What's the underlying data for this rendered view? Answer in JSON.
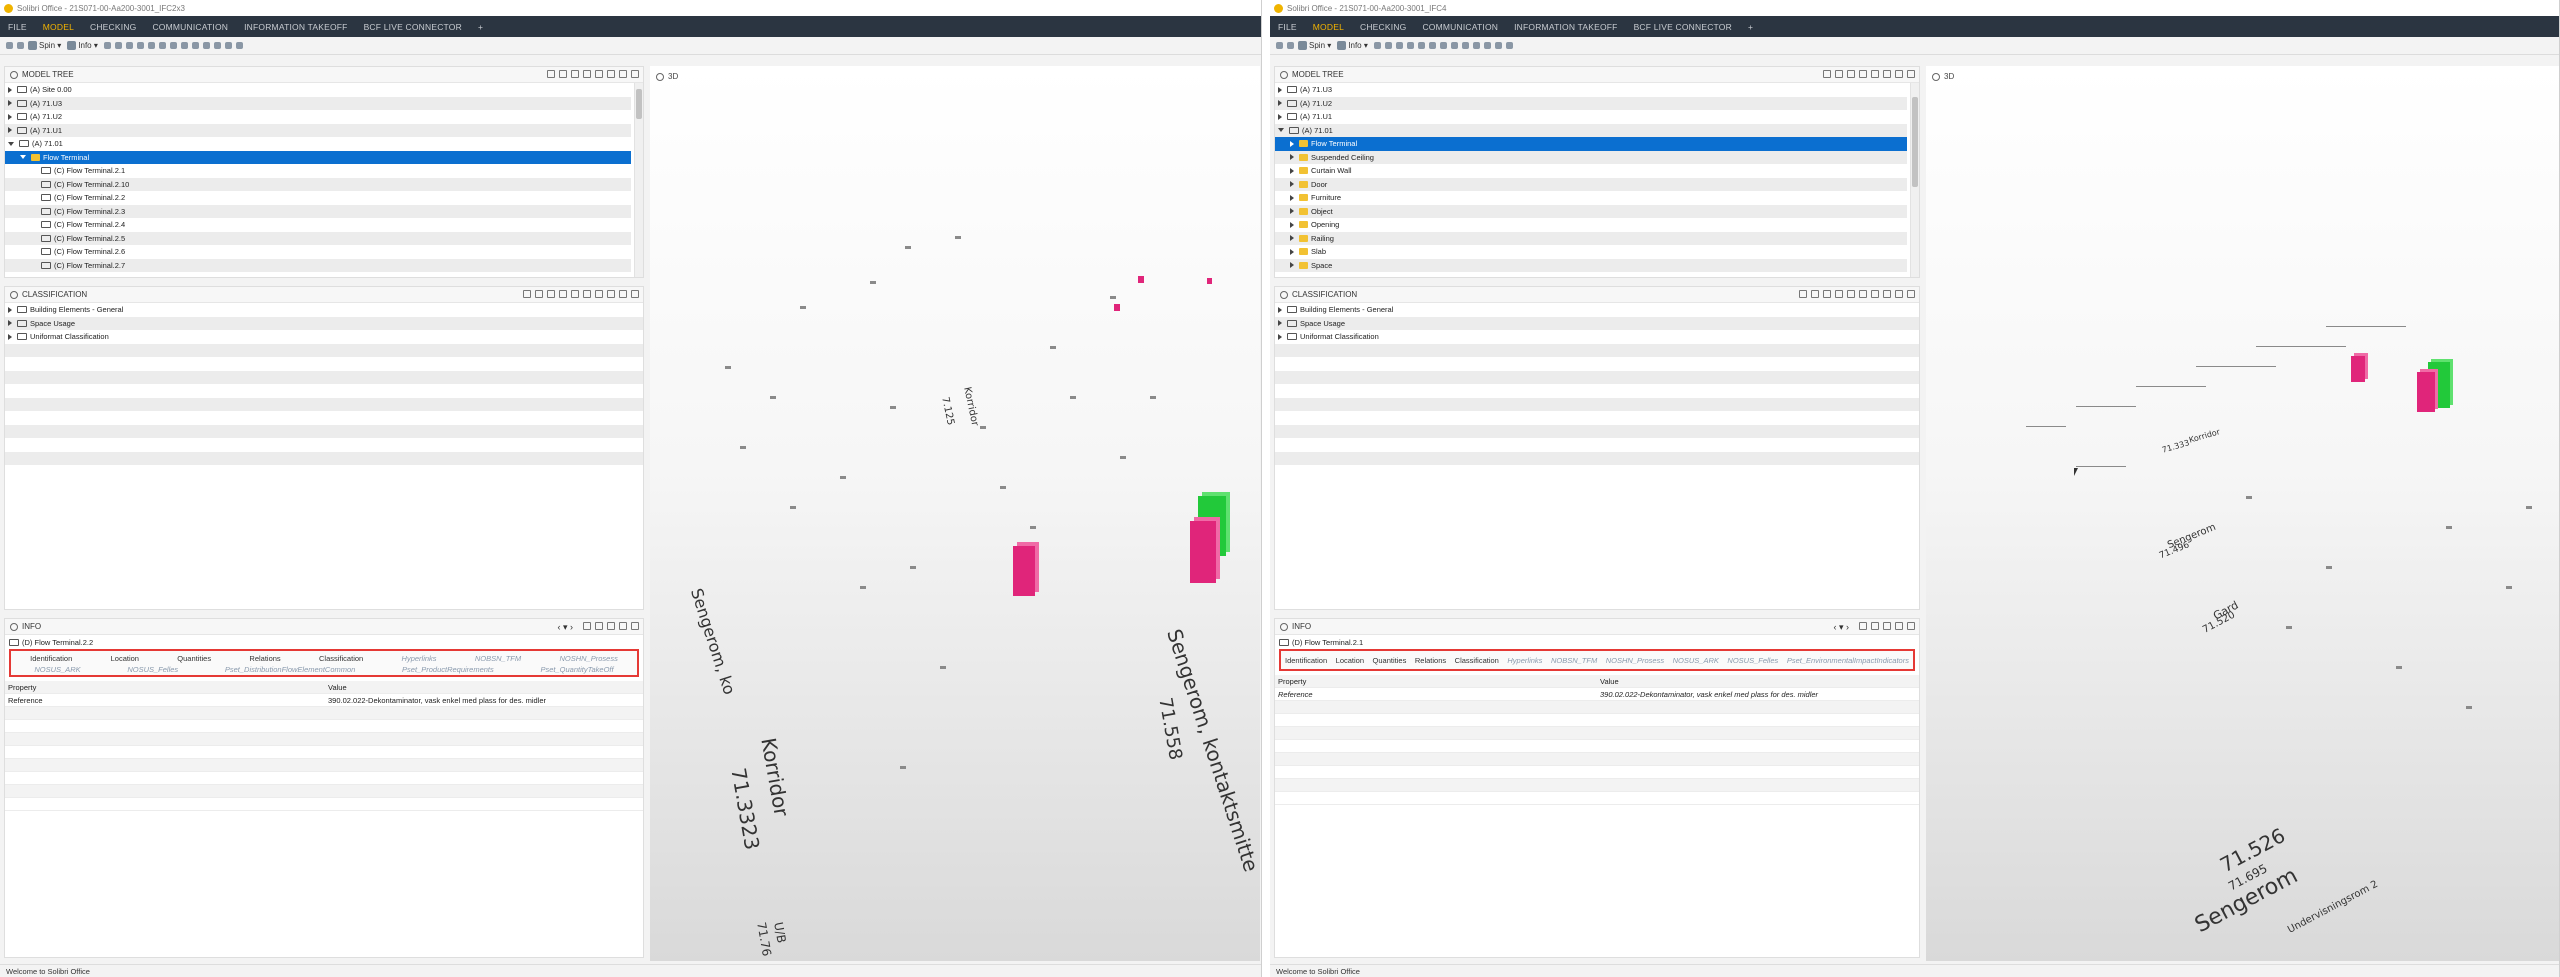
{
  "left": {
    "title": "Solibri Office - 21S071-00-Aa200-3001_IFC2x3",
    "menu": [
      "FILE",
      "MODEL",
      "CHECKING",
      "COMMUNICATION",
      "INFORMATION TAKEOFF",
      "BCF LIVE CONNECTOR"
    ],
    "active_menu": "MODEL",
    "toolbar": {
      "spin": "Spin",
      "info": "Info"
    },
    "model_tree": {
      "header": "MODEL TREE",
      "rows": [
        {
          "label": "(A) Site 0.00",
          "indent": 0,
          "state": "closed"
        },
        {
          "label": "(A) 71.U3",
          "indent": 0,
          "state": "closed"
        },
        {
          "label": "(A) 71.U2",
          "indent": 0,
          "state": "closed"
        },
        {
          "label": "(A) 71.U1",
          "indent": 0,
          "state": "closed"
        },
        {
          "label": "(A) 71.01",
          "indent": 0,
          "state": "open"
        },
        {
          "label": "Flow Terminal",
          "indent": 1,
          "state": "open",
          "selected": true,
          "folder": true
        },
        {
          "label": "(C) Flow Terminal.2.1",
          "indent": 2,
          "state": "leaf"
        },
        {
          "label": "(C) Flow Terminal.2.10",
          "indent": 2,
          "state": "leaf"
        },
        {
          "label": "(C) Flow Terminal.2.2",
          "indent": 2,
          "state": "leaf"
        },
        {
          "label": "(C) Flow Terminal.2.3",
          "indent": 2,
          "state": "leaf"
        },
        {
          "label": "(C) Flow Terminal.2.4",
          "indent": 2,
          "state": "leaf"
        },
        {
          "label": "(C) Flow Terminal.2.5",
          "indent": 2,
          "state": "leaf"
        },
        {
          "label": "(C) Flow Terminal.2.6",
          "indent": 2,
          "state": "leaf"
        },
        {
          "label": "(C) Flow Terminal.2.7",
          "indent": 2,
          "state": "leaf"
        }
      ]
    },
    "classification": {
      "header": "CLASSIFICATION",
      "rows": [
        "Building Elements - General",
        "Space Usage",
        "Uniformat Classification"
      ]
    },
    "info": {
      "header": "INFO",
      "selected": "(D) Flow Terminal.2.2",
      "tabs_row1": [
        "Identification",
        "Location",
        "Quantities",
        "Relations",
        "Classification",
        "Hyperlinks",
        "NOBSN_TFM",
        "NOSHN_Prosess"
      ],
      "tabs_row2": [
        "NOSUS_ARK",
        "NOSUS_Felles",
        "Pset_DistributionFlowElementCommon",
        "Pset_ProductRequirements",
        "Pset_QuantityTakeOff"
      ],
      "col_property": "Property",
      "col_value": "Value",
      "row_property": "Reference",
      "row_value": "390.02.022-Dekontaminator, vask enkel med plass for des. midler"
    },
    "viewport": {
      "label": "3D",
      "texts": [
        "Sengerom, ko",
        "Korridor",
        "71.3323",
        "Sengerom, kontaktsmitte",
        "71.558",
        "U/B",
        "71.76",
        "Korridor",
        "7.125"
      ]
    },
    "status": "Welcome to Solibri Office"
  },
  "right": {
    "title": "Solibri Office - 21S071-00-Aa200-3001_IFC4",
    "menu": [
      "FILE",
      "MODEL",
      "CHECKING",
      "COMMUNICATION",
      "INFORMATION TAKEOFF",
      "BCF LIVE CONNECTOR"
    ],
    "active_menu": "MODEL",
    "toolbar": {
      "spin": "Spin",
      "info": "Info"
    },
    "model_tree": {
      "header": "MODEL TREE",
      "rows": [
        {
          "label": "(A) 71.U3",
          "indent": 0,
          "state": "closed"
        },
        {
          "label": "(A) 71.U2",
          "indent": 0,
          "state": "closed"
        },
        {
          "label": "(A) 71.U1",
          "indent": 0,
          "state": "closed"
        },
        {
          "label": "(A) 71.01",
          "indent": 0,
          "state": "open"
        },
        {
          "label": "Flow Terminal",
          "indent": 1,
          "state": "closed",
          "selected": true,
          "folder": true
        },
        {
          "label": "Suspended Ceiling",
          "indent": 1,
          "state": "closed",
          "folder": true
        },
        {
          "label": "Curtain Wall",
          "indent": 1,
          "state": "closed",
          "folder": true
        },
        {
          "label": "Door",
          "indent": 1,
          "state": "closed",
          "folder": true
        },
        {
          "label": "Furniture",
          "indent": 1,
          "state": "closed",
          "folder": true
        },
        {
          "label": "Object",
          "indent": 1,
          "state": "closed",
          "folder": true
        },
        {
          "label": "Opening",
          "indent": 1,
          "state": "closed",
          "folder": true
        },
        {
          "label": "Railing",
          "indent": 1,
          "state": "closed",
          "folder": true
        },
        {
          "label": "Slab",
          "indent": 1,
          "state": "closed",
          "folder": true
        },
        {
          "label": "Space",
          "indent": 1,
          "state": "closed",
          "folder": true
        }
      ]
    },
    "classification": {
      "header": "CLASSIFICATION",
      "rows": [
        "Building Elements - General",
        "Space Usage",
        "Uniformat Classification"
      ]
    },
    "info": {
      "header": "INFO",
      "selected": "(D) Flow Terminal.2.1",
      "tabs_row1": [
        "Identification",
        "Location",
        "Quantities",
        "Relations",
        "Classification",
        "Hyperlinks",
        "NOBSN_TFM",
        "NOSHN_Prosess",
        "NOSUS_ARK",
        "NOSUS_Felles",
        "Pset_EnvironmentalImpactIndicators"
      ],
      "col_property": "Property",
      "col_value": "Value",
      "row_property": "Reference",
      "row_value": "390.02.022-Dekontaminator, vask enkel med plass for des. midler"
    },
    "viewport": {
      "label": "3D",
      "texts": [
        "71.526",
        "Sengerom",
        "71.695",
        "Undervisningsrom 2",
        "Gard",
        "71.520",
        "Sengerom",
        "71.496",
        "Korridor",
        "71.333"
      ]
    },
    "status": "Welcome to Solibri Office"
  },
  "colors": {
    "menubar": "#2b3541",
    "accent": "#f4b400",
    "selection": "#0b6fd0",
    "highlight": "#e53935",
    "magenta": "#e0257a",
    "green": "#22c93a"
  }
}
